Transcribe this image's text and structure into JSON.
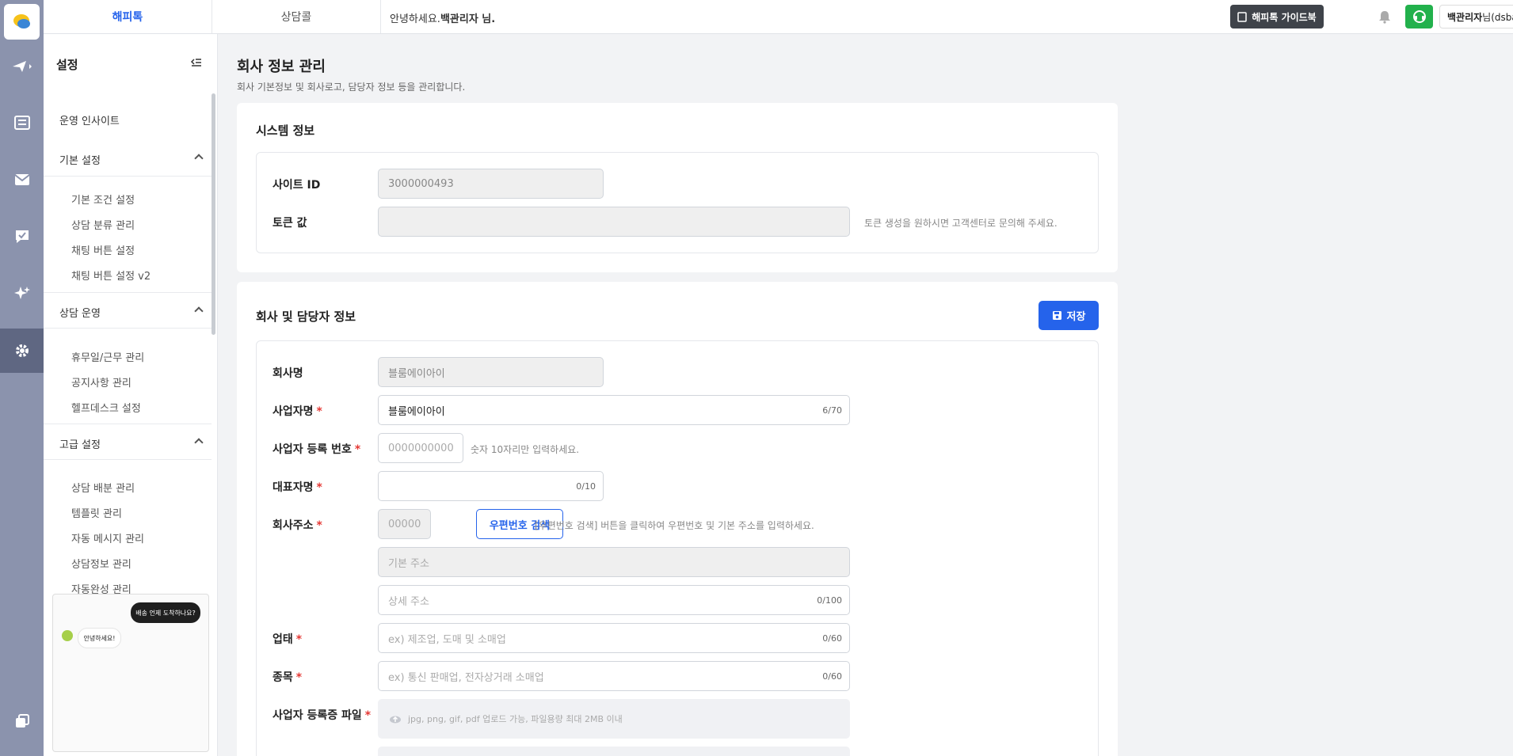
{
  "rail": {
    "items": [
      "send-icon",
      "list-icon",
      "mail-icon",
      "chat-check-icon",
      "sparkle-icon",
      "gear-icon",
      "copy-icon"
    ]
  },
  "topbar": {
    "tab_happy": "해피톡",
    "tab_call": "상담콜",
    "greeting_prefix": "안녕하세요.",
    "greeting_name": "백관리자 님.",
    "guide_label": "해피톡 가이드북",
    "user_name": "백관리자",
    "user_suffix": "님(dsbaek)"
  },
  "sidebar": {
    "title": "설정",
    "insight": "운영 인사이트",
    "groups": [
      {
        "label": "기본 설정",
        "items": [
          "기본 조건 설정",
          "상담 분류 관리",
          "채팅 버튼 설정",
          "채팅 버튼 설정 v2"
        ]
      },
      {
        "label": "상담 운영",
        "items": [
          "휴무일/근무 관리",
          "공지사항 관리",
          "헬프데스크 설정"
        ]
      },
      {
        "label": "고급 설정",
        "items": [
          "상담 배분 관리",
          "템플릿 관리",
          "자동 메시지 관리",
          "상담정보 관리",
          "자동완성 관리"
        ]
      }
    ],
    "preview": {
      "bubble_dark": "배송 언제 도착하나요?",
      "bubble_light": "안녕하세요!"
    }
  },
  "main": {
    "title": "회사 정보 관리",
    "description": "회사 기본정보 및 회사로고, 담당자 정보 등을 관리합니다.",
    "system": {
      "title": "시스템 정보",
      "site_id_label": "사이트 ID",
      "site_id_value": "3000000493",
      "token_label": "토큰 값",
      "token_value": "",
      "token_hint": "토큰 생성을 원하시면 고객센터로 문의해 주세요."
    },
    "company": {
      "title": "회사 및 담당자 정보",
      "save_label": "저장",
      "company_name_label": "회사명",
      "company_name_value": "블룸에이아이",
      "biz_name_label": "사업자명",
      "biz_name_value": "블룸에이아이",
      "biz_name_count": "6/70",
      "biz_no_label": "사업자 등록 번호",
      "biz_no_placeholder": "0000000000",
      "biz_no_hint": "숫자 10자리만 입력하세요.",
      "ceo_label": "대표자명",
      "ceo_count": "0/10",
      "address_label": "회사주소",
      "zip_placeholder": "00000",
      "zip_button": "우편번호 검색",
      "zip_hint": "[우편번호 검색] 버튼을 클릭하여 우편번호 및 기본 주소를 입력하세요.",
      "base_addr_placeholder": "기본 주소",
      "detail_addr_placeholder": "상세 주소",
      "detail_addr_count": "0/100",
      "biz_type_label": "업태",
      "biz_type_placeholder": "ex) 제조업, 도매 및 소매업",
      "biz_type_count": "0/60",
      "biz_item_label": "종목",
      "biz_item_placeholder": "ex) 통신 판매업, 전자상거래 소매업",
      "biz_item_count": "0/60",
      "file_label": "사업자 등록증 파일",
      "file_hint": "jpg, png, gif, pdf 업로드 가능, 파일용량 최대 2MB 이내"
    }
  },
  "colors": {
    "accent": "#2563eb",
    "rail": "#8b93ad",
    "support": "#22b14c",
    "required": "#e53935"
  }
}
